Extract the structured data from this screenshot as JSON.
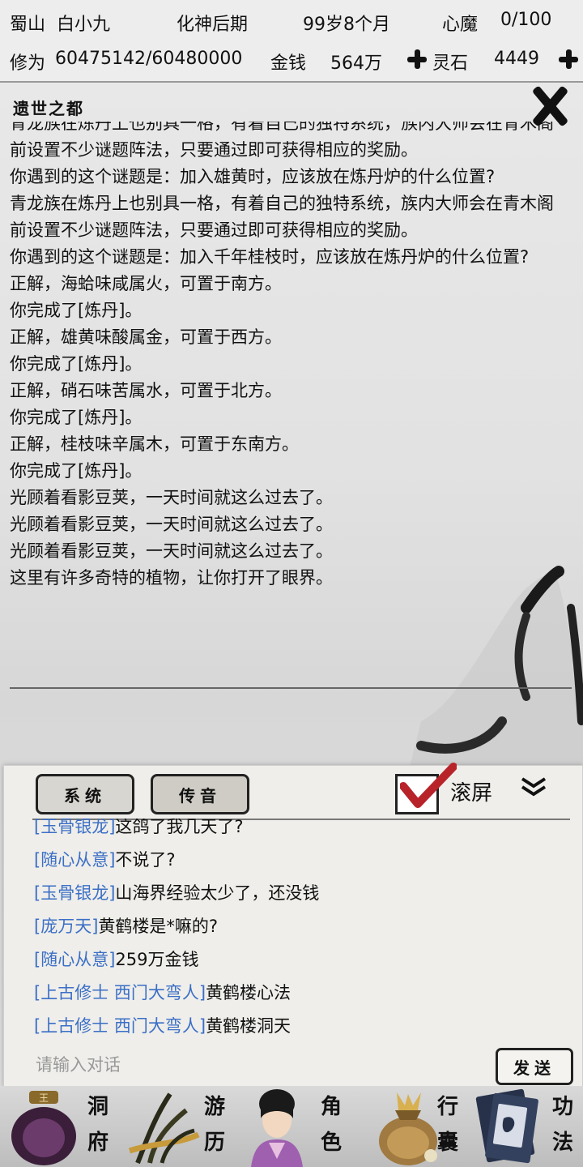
{
  "status": {
    "sect": "蜀山",
    "name": "白小九",
    "realm": "化神后期",
    "age": "99岁8个月",
    "heart_demon_label": "心魔",
    "heart_demon_value": "0/100",
    "cultivation_label": "修为",
    "cultivation_value": "60475142/60480000",
    "money_label": "金钱",
    "money_value": "564万",
    "spirit_stone_label": "灵石",
    "spirit_stone_value": "4449"
  },
  "panel": {
    "title": "遗世之都",
    "log": [
      "青龙族在炼丹上也别具一格，有着自己的独特系统，族内大师会在青木阁前设置不少谜题阵法，只要通过即可获得相应的奖励。",
      "你遇到的这个谜题是：加入雄黄时，应该放在炼丹炉的什么位置?",
      "青龙族在炼丹上也别具一格，有着自己的独特系统，族内大师会在青木阁前设置不少谜题阵法，只要通过即可获得相应的奖励。",
      "你遇到的这个谜题是：加入千年桂枝时，应该放在炼丹炉的什么位置?",
      "正解，海蛤味咸属火，可置于南方。",
      "你完成了[炼丹]。",
      "正解，雄黄味酸属金，可置于西方。",
      "你完成了[炼丹]。",
      "正解，硝石味苦属水，可置于北方。",
      "你完成了[炼丹]。",
      "正解，桂枝味辛属木，可置于东南方。",
      "你完成了[炼丹]。",
      "光顾着看影豆荚，一天时间就这么过去了。",
      "光顾着看影豆荚，一天时间就这么过去了。",
      "光顾着看影豆荚，一天时间就这么过去了。",
      "这里有许多奇特的植物，让你打开了眼界。"
    ]
  },
  "chat": {
    "tab_system": "系统",
    "tab_voice": "传音",
    "scroll_label": "滚屏",
    "scroll_checked": true,
    "messages": [
      {
        "name": "[玉骨银龙]",
        "text": "这鸽了我几天了?"
      },
      {
        "name": "[随心从意]",
        "text": "不说了?"
      },
      {
        "name": "[玉骨银龙]",
        "text": "山海界经验太少了，还没钱"
      },
      {
        "name": "[庞万天]",
        "text": "黄鹤楼是*嘛的?"
      },
      {
        "name": "[随心从意]",
        "text": "259万金钱"
      },
      {
        "name": "[上古修士 西门大弯人]",
        "text": "黄鹤楼心法"
      },
      {
        "name": "[上古修士 西门大弯人]",
        "text": "黄鹤楼洞天"
      }
    ],
    "input_placeholder": "请输入对话",
    "send_label": "发送"
  },
  "nav": {
    "cave": [
      "洞",
      "府"
    ],
    "travel": [
      "游",
      "历"
    ],
    "character": [
      "角",
      "色"
    ],
    "bag": [
      "行",
      "囊"
    ],
    "skills": [
      "功",
      "法"
    ]
  },
  "colors": {
    "player_name": "#3b6fc6",
    "check_mark": "#b8232a"
  }
}
